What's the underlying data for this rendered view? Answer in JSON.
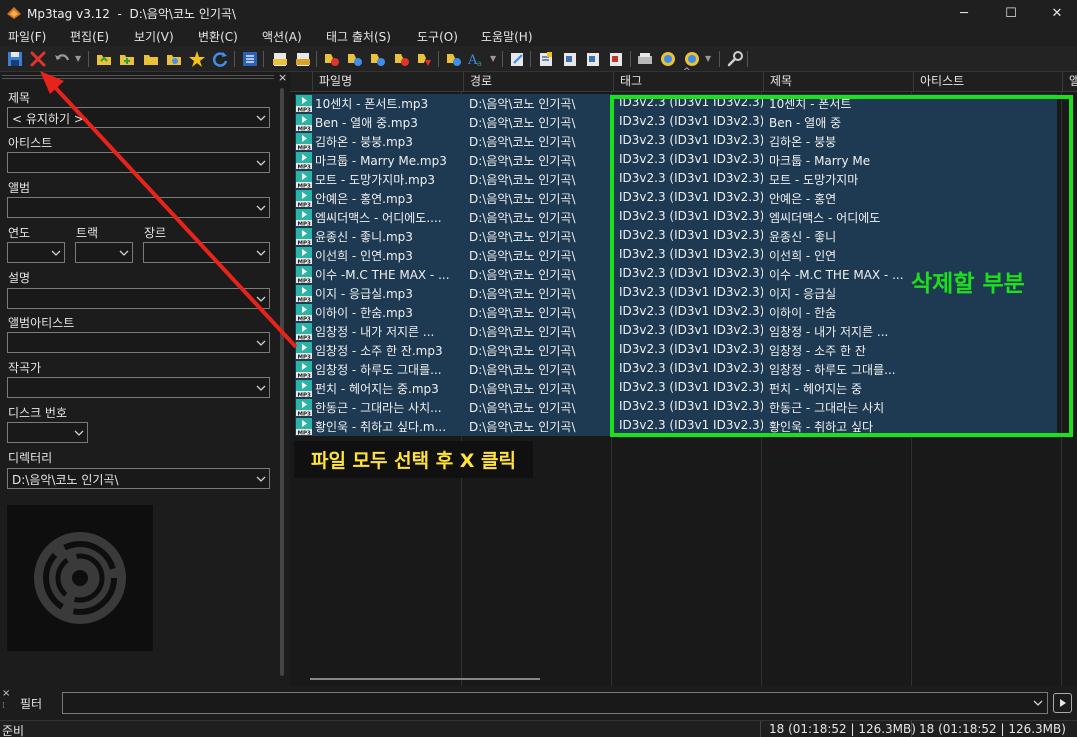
{
  "window": {
    "title": "Mp3tag v3.12  -  D:\\음악\\코노 인기곡\\",
    "minimize": "─",
    "maximize": "☐",
    "close": "✕"
  },
  "menu": [
    "파일(F)",
    "편집(E)",
    "보기(V)",
    "변환(C)",
    "액션(A)",
    "태그 출처(S)",
    "도구(O)",
    "도움말(H)"
  ],
  "toolbar_icons": [
    "save-icon",
    "remove-tag-icon",
    "undo-icon",
    "change-directory-icon",
    "add-directory-icon",
    "open-folder-icon",
    "favorites-icon",
    "favorites-star-icon",
    "refresh-icon",
    "tag-panel-icon",
    "tag-to-filename-icon",
    "filename-to-tag-icon",
    "text-file-icon",
    "case-conversion-icon",
    "export-icon",
    "playlist-icon",
    "auto-numbering-icon",
    "options-icon"
  ],
  "tag_panel": {
    "close": "×",
    "fields": [
      {
        "label": "제목",
        "value": "< 유지하기 >"
      },
      {
        "label": "아티스트",
        "value": ""
      },
      {
        "label": "앨범",
        "value": ""
      },
      {
        "label": "설명",
        "value": ""
      },
      {
        "label": "앨범아티스트",
        "value": ""
      },
      {
        "label": "작곡가",
        "value": ""
      }
    ],
    "year_label": "연도",
    "track_label": "트랙",
    "genre_label": "장르",
    "disc_label": "디스크 번호",
    "directory_label": "디렉터리",
    "directory_value": "D:\\음악\\코노 인기곡\\"
  },
  "columns": [
    "파일명",
    "경로",
    "태그",
    "제목",
    "아티스트",
    "앨"
  ],
  "rows": [
    {
      "file": "10센치 - 폰서트.mp3",
      "path": "D:\\음악\\코노 인기곡\\",
      "tag": "ID3v2.3 (ID3v1 ID3v2.3)",
      "title": "10센치 - 폰서트"
    },
    {
      "file": "Ben - 열애 중.mp3",
      "path": "D:\\음악\\코노 인기곡\\",
      "tag": "ID3v2.3 (ID3v1 ID3v2.3)",
      "title": "Ben - 열애 중"
    },
    {
      "file": "김하온 - 붕붕.mp3",
      "path": "D:\\음악\\코노 인기곡\\",
      "tag": "ID3v2.3 (ID3v1 ID3v2.3)",
      "title": "김하온 - 붕붕"
    },
    {
      "file": "마크툽 - Marry Me.mp3",
      "path": "D:\\음악\\코노 인기곡\\",
      "tag": "ID3v2.3 (ID3v1 ID3v2.3)",
      "title": "마크툽 - Marry Me"
    },
    {
      "file": "모트 - 도망가지마.mp3",
      "path": "D:\\음악\\코노 인기곡\\",
      "tag": "ID3v2.3 (ID3v1 ID3v2.3)",
      "title": "모트 - 도망가지마"
    },
    {
      "file": "안예은 - 홍연.mp3",
      "path": "D:\\음악\\코노 인기곡\\",
      "tag": "ID3v2.3 (ID3v1 ID3v2.3)",
      "title": "안예은 - 홍연"
    },
    {
      "file": "엠씨더맥스 - 어디에도....",
      "path": "D:\\음악\\코노 인기곡\\",
      "tag": "ID3v2.3 (ID3v1 ID3v2.3)",
      "title": "엠씨더맥스 - 어디에도"
    },
    {
      "file": "윤종신 - 좋니.mp3",
      "path": "D:\\음악\\코노 인기곡\\",
      "tag": "ID3v2.3 (ID3v1 ID3v2.3)",
      "title": "윤종신 - 좋니"
    },
    {
      "file": "이선희 - 인연.mp3",
      "path": "D:\\음악\\코노 인기곡\\",
      "tag": "ID3v2.3 (ID3v1 ID3v2.3)",
      "title": "이선희 - 인연"
    },
    {
      "file": "이수 -M.C THE MAX - ...",
      "path": "D:\\음악\\코노 인기곡\\",
      "tag": "ID3v2.3 (ID3v1 ID3v2.3)",
      "title": "이수 -M.C THE MAX - ..."
    },
    {
      "file": "이지 - 응급실.mp3",
      "path": "D:\\음악\\코노 인기곡\\",
      "tag": "ID3v2.3 (ID3v1 ID3v2.3)",
      "title": "이지 - 응급실"
    },
    {
      "file": "이하이 - 한숨.mp3",
      "path": "D:\\음악\\코노 인기곡\\",
      "tag": "ID3v2.3 (ID3v1 ID3v2.3)",
      "title": "이하이 - 한숨"
    },
    {
      "file": "임창정 - 내가 저지른 ...",
      "path": "D:\\음악\\코노 인기곡\\",
      "tag": "ID3v2.3 (ID3v1 ID3v2.3)",
      "title": "임창정 - 내가 저지른 ..."
    },
    {
      "file": "임창정 - 소주 한 잔.mp3",
      "path": "D:\\음악\\코노 인기곡\\",
      "tag": "ID3v2.3 (ID3v1 ID3v2.3)",
      "title": "임창정 - 소주 한 잔"
    },
    {
      "file": "임창정 - 하루도 그대를...",
      "path": "D:\\음악\\코노 인기곡\\",
      "tag": "ID3v2.3 (ID3v1 ID3v2.3)",
      "title": "임창정 - 하루도 그대를..."
    },
    {
      "file": "펀치 - 헤어지는 중.mp3",
      "path": "D:\\음악\\코노 인기곡\\",
      "tag": "ID3v2.3 (ID3v1 ID3v2.3)",
      "title": "펀치 - 헤어지는 중"
    },
    {
      "file": "한동근 - 그대라는 사치...",
      "path": "D:\\음악\\코노 인기곡\\",
      "tag": "ID3v2.3 (ID3v1 ID3v2.3)",
      "title": "한동근 - 그대라는 사치"
    },
    {
      "file": "황인욱 - 취하고 싶다.m...",
      "path": "D:\\음악\\코노 인기곡\\",
      "tag": "ID3v2.3 (ID3v1 ID3v2.3)",
      "title": "황인욱 - 취하고 싶다"
    }
  ],
  "annotations": {
    "delete_area": "삭제할 부분",
    "instruction": "파일 모두 선택 후 X 클릭",
    "arrow_color": "#e8231b",
    "box_color": "#1de01d"
  },
  "filter": {
    "label": "필터",
    "value": ""
  },
  "status": {
    "ready": "준비",
    "selected": "18 (01:18:52 | 126.3MB)",
    "total": "18 (01:18:52 | 126.3MB)"
  },
  "colors": {
    "background": "#191919",
    "selection": "#1e3a52",
    "text": "#e6e6e6"
  }
}
